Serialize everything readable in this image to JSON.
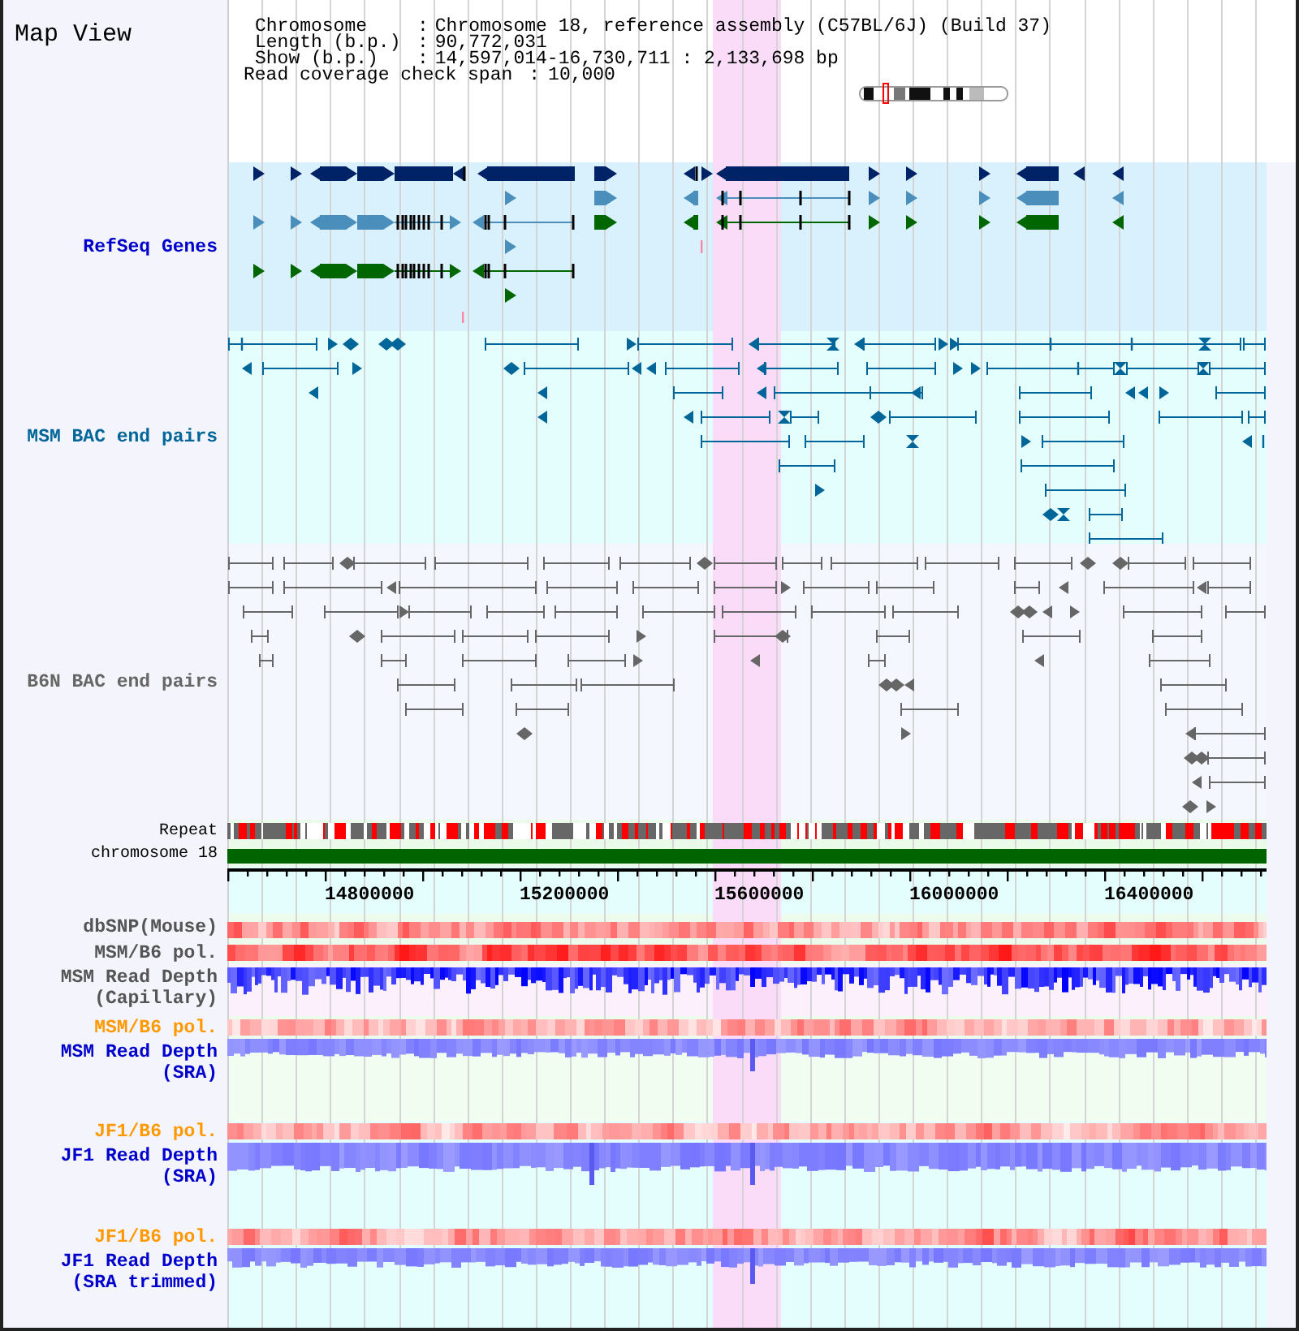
{
  "view": {
    "title": "Map View"
  },
  "header": {
    "fields": [
      {
        "label": "Chromosome",
        "separator": ":",
        "value": "Chromosome 18, reference assembly (C57BL/6J) (Build 37)"
      },
      {
        "label": "Length (b.p.)",
        "separator": ":",
        "value": "90,772,031"
      },
      {
        "label": "Show (b.p.)",
        "separator": ":",
        "value": "14,597,014-16,730,711 : 2,133,698 bp"
      }
    ],
    "coverage_span": {
      "label": "Read coverage check span",
      "separator": ":",
      "value": "10,000"
    }
  },
  "tracks": [
    {
      "kind": "genes",
      "label": "RefSeq Genes",
      "color": "#0000cc"
    },
    {
      "kind": "bac",
      "label": "MSM BAC end pairs",
      "color": "#006699"
    },
    {
      "kind": "bac",
      "label": "B6N BAC end pairs",
      "color": "#666666"
    },
    {
      "kind": "repeat",
      "label": "Repeat",
      "color": "#000000"
    },
    {
      "kind": "chromosome",
      "label": "chromosome 18",
      "color": "#000000"
    },
    {
      "kind": "axis",
      "ticks": [
        "14800000",
        "15200000",
        "15600000",
        "16000000",
        "16400000"
      ]
    },
    {
      "kind": "heat",
      "label": "dbSNP(Mouse)",
      "color": "#555555"
    },
    {
      "kind": "heat",
      "label": "MSM/B6 pol.",
      "color": "#555555"
    },
    {
      "kind": "depth",
      "label": "MSM Read Depth (Capillary)",
      "color": "#555555"
    },
    {
      "kind": "heat",
      "label": "MSM/B6 pol.",
      "color": "#ff9900"
    },
    {
      "kind": "depth",
      "label": "MSM Read Depth (SRA)",
      "color": "#0000cc"
    },
    {
      "kind": "heat",
      "label": "JF1/B6 pol.",
      "color": "#ff9900"
    },
    {
      "kind": "depth",
      "label": "JF1 Read Depth (SRA)",
      "color": "#0000cc"
    },
    {
      "kind": "heat",
      "label": "JF1/B6 pol.",
      "color": "#ff9900"
    },
    {
      "kind": "depth",
      "label": "JF1 Read Depth (SRA trimmed)",
      "color": "#0000cc"
    }
  ]
}
